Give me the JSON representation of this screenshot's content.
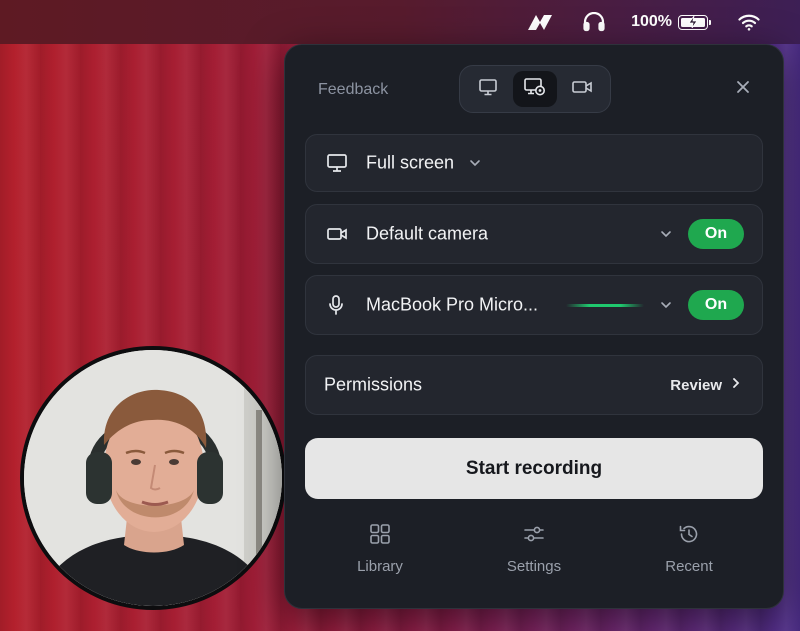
{
  "menubar": {
    "battery_percent": "100%"
  },
  "panel": {
    "title": "Feedback",
    "mode_tabs": [
      {
        "icon": "monitor-icon",
        "active": false
      },
      {
        "icon": "screen-camera-icon",
        "active": true
      },
      {
        "icon": "video-camera-icon",
        "active": false
      }
    ],
    "display_source": {
      "label": "Full screen"
    },
    "camera": {
      "label": "Default camera",
      "toggle": "On"
    },
    "microphone": {
      "label": "MacBook Pro Micro...",
      "toggle": "On"
    },
    "permissions": {
      "label": "Permissions",
      "action": "Review"
    },
    "start_button": "Start recording",
    "nav": [
      {
        "label": "Library",
        "icon": "grid-icon"
      },
      {
        "label": "Settings",
        "icon": "sliders-icon"
      },
      {
        "label": "Recent",
        "icon": "history-icon"
      }
    ]
  },
  "colors": {
    "panel_bg": "#1c1f26",
    "toggle_on": "#1fa84f",
    "start_button_bg": "#e6e6e6"
  }
}
